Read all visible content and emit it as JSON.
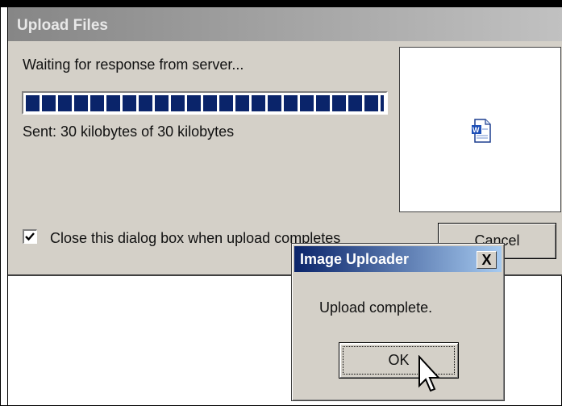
{
  "upload_window": {
    "title": "Upload Files",
    "status": "Waiting for response from server...",
    "progress": 1.0,
    "sent": "Sent: 30 kilobytes of 30 kilobytes",
    "preview_icon": "word-document-icon",
    "close_on_complete_checked": true,
    "close_on_complete_label": "Close this dialog box when upload completes",
    "cancel_label": "Cancel"
  },
  "message_box": {
    "title": "Image Uploader",
    "close_glyph": "X",
    "message": "Upload complete.",
    "ok_label": "OK"
  },
  "colors": {
    "progress_blue": "#0a246a",
    "active_title_start": "#0a246a",
    "active_title_end": "#a6caf0",
    "inactive_title": "#868686",
    "dialog_face": "#d4d0c8"
  }
}
